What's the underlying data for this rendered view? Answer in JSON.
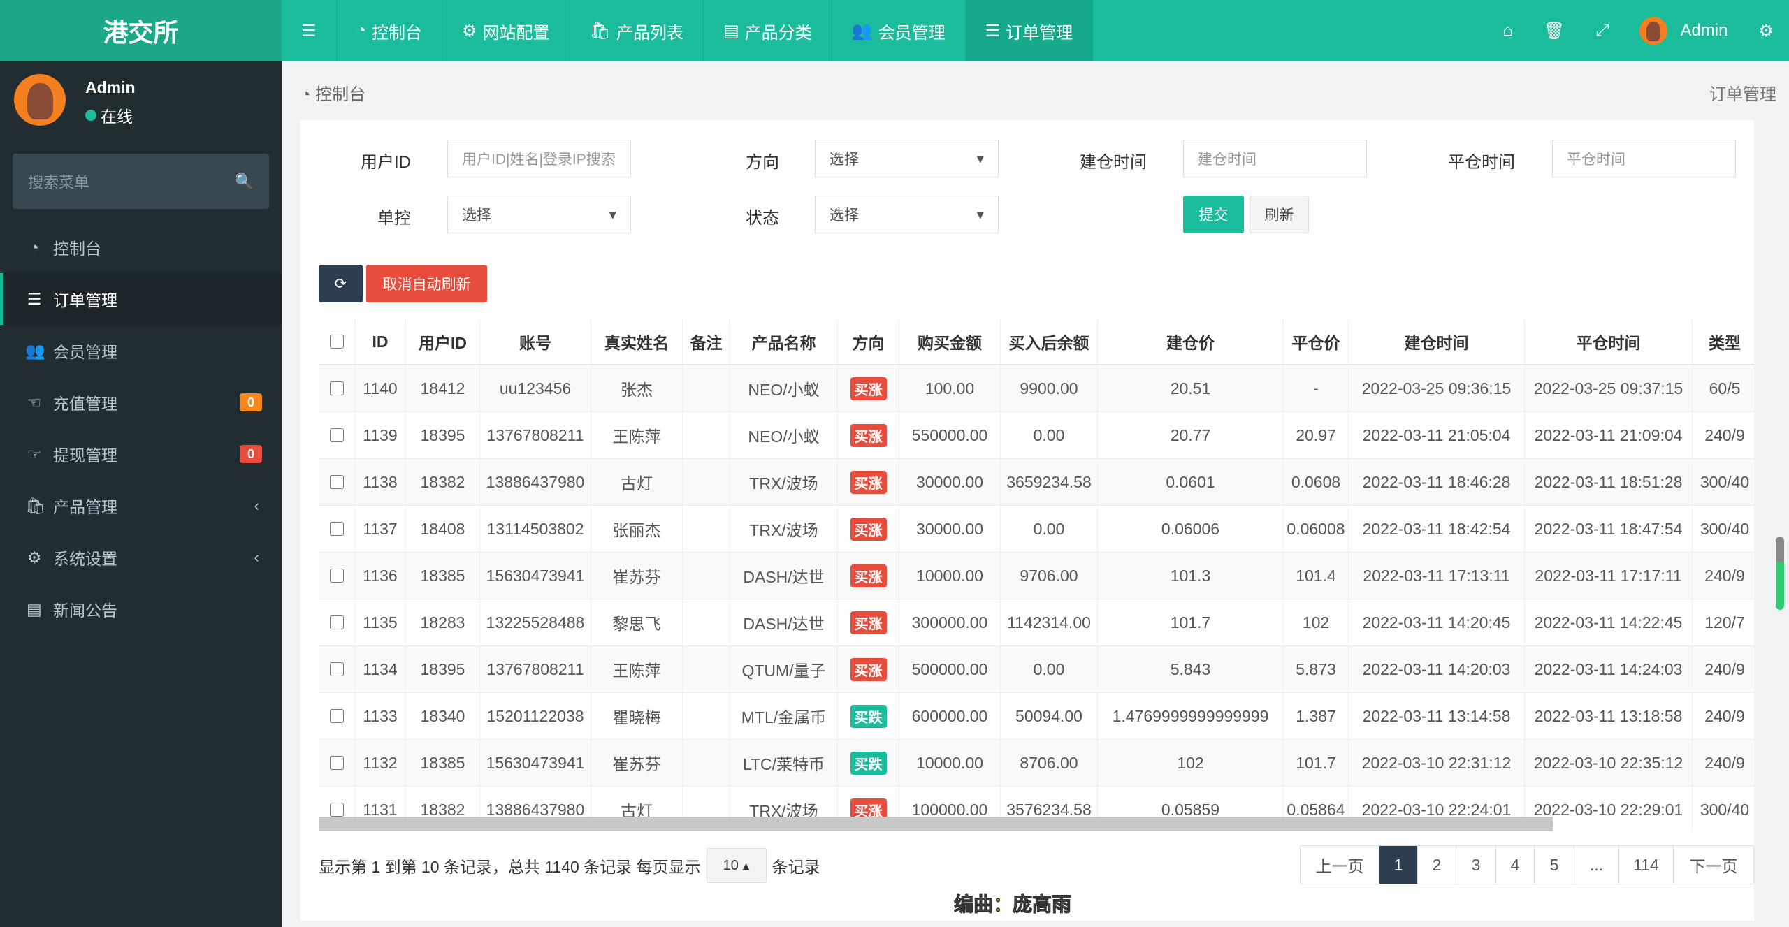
{
  "brand": "港交所",
  "topnav": [
    {
      "icon": "dashboard-icon",
      "label": "控制台"
    },
    {
      "icon": "gear-icon",
      "label": "网站配置"
    },
    {
      "icon": "shopping-bag-icon",
      "label": "产品列表"
    },
    {
      "icon": "list-alt-icon",
      "label": "产品分类"
    },
    {
      "icon": "users-icon",
      "label": "会员管理"
    },
    {
      "icon": "ordered-list-icon",
      "label": "订单管理",
      "active": true
    }
  ],
  "topright": {
    "user": "Admin"
  },
  "user": {
    "name": "Admin",
    "status": "在线"
  },
  "sidebar": {
    "search_placeholder": "搜索菜单",
    "items": [
      {
        "label": "控制台",
        "icon": "dashboard-icon"
      },
      {
        "label": "订单管理",
        "icon": "ordered-list-icon",
        "active": true
      },
      {
        "label": "会员管理",
        "icon": "users-icon"
      },
      {
        "label": "充值管理",
        "icon": "hand-point-left-icon",
        "badge": "0",
        "badge_color": "#f7861e"
      },
      {
        "label": "提现管理",
        "icon": "hand-point-right-icon",
        "badge": "0",
        "badge_color": "#e74c3c"
      },
      {
        "label": "产品管理",
        "icon": "shopping-bag-icon",
        "chevron": true
      },
      {
        "label": "系统设置",
        "icon": "cogs-icon",
        "chevron": true
      },
      {
        "label": "新闻公告",
        "icon": "newspaper-icon"
      }
    ]
  },
  "breadcrumb": {
    "home": "控制台",
    "current": "订单管理"
  },
  "filters": {
    "user_id_label": "用户ID",
    "user_id_placeholder": "用户ID|姓名|登录IP搜索",
    "direction_label": "方向",
    "direction_value": "选择",
    "open_time_label": "建仓时间",
    "open_time_placeholder": "建仓时间",
    "close_time_label": "平仓时间",
    "close_time_placeholder": "平仓时间",
    "control_label": "单控",
    "control_value": "选择",
    "status_label": "状态",
    "status_value": "选择",
    "submit": "提交",
    "reset": "刷新"
  },
  "toolbar": {
    "cancel_refresh": "取消自动刷新"
  },
  "table": {
    "headers": [
      "ID",
      "用户ID",
      "账号",
      "真实姓名",
      "备注",
      "产品名称",
      "方向",
      "购买金额",
      "买入后余额",
      "建仓价",
      "平仓价",
      "建仓时间",
      "平仓时间",
      "类型"
    ],
    "rows": [
      [
        "1140",
        "18412",
        "uu123456",
        "张杰",
        "",
        "NEO/小蚁",
        "买涨",
        "100.00",
        "9900.00",
        "20.51",
        "-",
        "2022-03-25 09:36:15",
        "2022-03-25 09:37:15",
        "60/5"
      ],
      [
        "1139",
        "18395",
        "13767808211",
        "王陈萍",
        "",
        "NEO/小蚁",
        "买涨",
        "550000.00",
        "0.00",
        "20.77",
        "20.97",
        "2022-03-11 21:05:04",
        "2022-03-11 21:09:04",
        "240/9"
      ],
      [
        "1138",
        "18382",
        "13886437980",
        "古灯",
        "",
        "TRX/波场",
        "买涨",
        "30000.00",
        "3659234.58",
        "0.0601",
        "0.0608",
        "2022-03-11 18:46:28",
        "2022-03-11 18:51:28",
        "300/40"
      ],
      [
        "1137",
        "18408",
        "13114503802",
        "张丽杰",
        "",
        "TRX/波场",
        "买涨",
        "30000.00",
        "0.00",
        "0.06006",
        "0.06008",
        "2022-03-11 18:42:54",
        "2022-03-11 18:47:54",
        "300/40"
      ],
      [
        "1136",
        "18385",
        "15630473941",
        "崔苏芬",
        "",
        "DASH/达世",
        "买涨",
        "10000.00",
        "9706.00",
        "101.3",
        "101.4",
        "2022-03-11 17:13:11",
        "2022-03-11 17:17:11",
        "240/9"
      ],
      [
        "1135",
        "18283",
        "13225528488",
        "黎思飞",
        "",
        "DASH/达世",
        "买涨",
        "300000.00",
        "1142314.00",
        "101.7",
        "102",
        "2022-03-11 14:20:45",
        "2022-03-11 14:22:45",
        "120/7"
      ],
      [
        "1134",
        "18395",
        "13767808211",
        "王陈萍",
        "",
        "QTUM/量子",
        "买涨",
        "500000.00",
        "0.00",
        "5.843",
        "5.873",
        "2022-03-11 14:20:03",
        "2022-03-11 14:24:03",
        "240/9"
      ],
      [
        "1133",
        "18340",
        "15201122038",
        "瞿晓梅",
        "",
        "MTL/金属币",
        "买跌",
        "600000.00",
        "50094.00",
        "1.4769999999999999",
        "1.387",
        "2022-03-11 13:14:58",
        "2022-03-11 13:18:58",
        "240/9"
      ],
      [
        "1132",
        "18385",
        "15630473941",
        "崔苏芬",
        "",
        "LTC/莱特币",
        "买跌",
        "10000.00",
        "8706.00",
        "102",
        "101.7",
        "2022-03-10 22:31:12",
        "2022-03-10 22:35:12",
        "240/9"
      ],
      [
        "1131",
        "18382",
        "13886437980",
        "古灯",
        "",
        "TRX/波场",
        "买涨",
        "100000.00",
        "3576234.58",
        "0.05859",
        "0.05864",
        "2022-03-10 22:24:01",
        "2022-03-10 22:29:01",
        "300/40"
      ]
    ]
  },
  "direction_colors": {
    "买涨": "#e74c3c",
    "买跌": "#1abc9c"
  },
  "footer": {
    "info_prefix": "显示第 1 到第 10 条记录，总共 1140 条记录 每页显示",
    "page_size": "10",
    "info_suffix": "条记录"
  },
  "pagination": {
    "prev": "上一页",
    "pages": [
      "1",
      "2",
      "3",
      "4",
      "5",
      "...",
      "114"
    ],
    "current": "1",
    "next": "下一页"
  },
  "watermark": "编曲：庞高雨",
  "colors": {
    "primary": "#1abc9c",
    "sidebar": "#222d32",
    "danger": "#e74c3c"
  }
}
